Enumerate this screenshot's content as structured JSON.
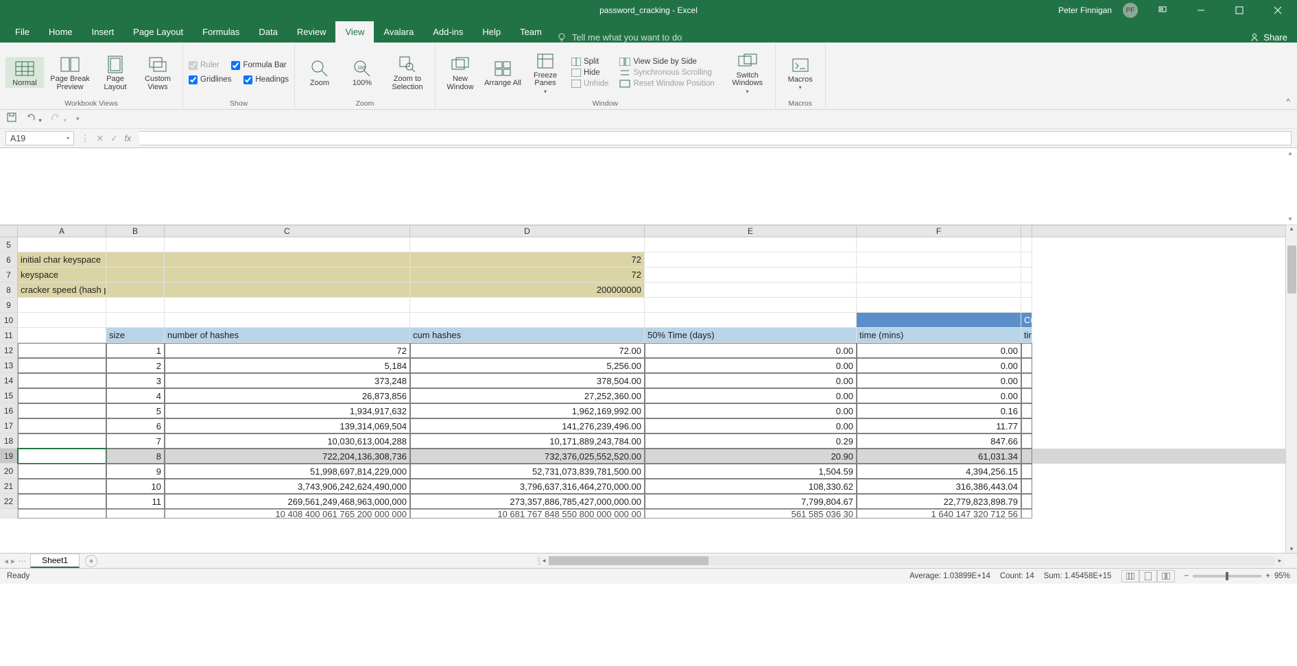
{
  "titlebar": {
    "title": "password_cracking  -  Excel",
    "user": "Peter Finnigan",
    "initials": "PF"
  },
  "ribbon": {
    "tabs": [
      "File",
      "Home",
      "Insert",
      "Page Layout",
      "Formulas",
      "Data",
      "Review",
      "View",
      "Avalara",
      "Add-ins",
      "Help",
      "Team"
    ],
    "active_tab": "View",
    "tell_me": "Tell me what you want to do",
    "share": "Share"
  },
  "view_ribbon": {
    "workbook_views": {
      "label": "Workbook Views",
      "normal": "Normal",
      "page_break": "Page Break Preview",
      "page_layout": "Page Layout",
      "custom": "Custom Views"
    },
    "show": {
      "label": "Show",
      "ruler": "Ruler",
      "formula_bar": "Formula Bar",
      "gridlines": "Gridlines",
      "headings": "Headings"
    },
    "zoom": {
      "label": "Zoom",
      "zoom": "Zoom",
      "hundred": "100%",
      "selection": "Zoom to Selection"
    },
    "window": {
      "label": "Window",
      "new_window": "New Window",
      "arrange": "Arrange All",
      "freeze": "Freeze Panes",
      "split": "Split",
      "hide": "Hide",
      "unhide": "Unhide",
      "side": "View Side by Side",
      "sync": "Synchronous Scrolling",
      "reset": "Reset Window Position",
      "switch": "Switch Windows"
    },
    "macros": {
      "label": "Macros",
      "macros": "Macros"
    }
  },
  "formula_bar": {
    "name_box": "A19",
    "fx": ""
  },
  "columns": [
    "A",
    "B",
    "C",
    "D",
    "E",
    "F"
  ],
  "first_visible_row": 5,
  "sheet": {
    "labels": {
      "initial_char": "initial char keyspace",
      "keyspace": "keyspace",
      "cracker_speed": "cracker speed (hash per second)"
    },
    "initial_char_val": "72",
    "keyspace_val": "72",
    "cracker_speed_val": "200000000",
    "table_headers": {
      "size": "size",
      "hashes": "number of hashes",
      "cum": "cum hashes",
      "days": "50% Time (days)",
      "mins": "time (mins)",
      "g_top": "Cu",
      "g_bot": "tir"
    },
    "rows": [
      {
        "n": 12,
        "b": "1",
        "c": "72",
        "d": "72.00",
        "e": "0.00",
        "f": "0.00"
      },
      {
        "n": 13,
        "b": "2",
        "c": "5,184",
        "d": "5,256.00",
        "e": "0.00",
        "f": "0.00"
      },
      {
        "n": 14,
        "b": "3",
        "c": "373,248",
        "d": "378,504.00",
        "e": "0.00",
        "f": "0.00"
      },
      {
        "n": 15,
        "b": "4",
        "c": "26,873,856",
        "d": "27,252,360.00",
        "e": "0.00",
        "f": "0.00"
      },
      {
        "n": 16,
        "b": "5",
        "c": "1,934,917,632",
        "d": "1,962,169,992.00",
        "e": "0.00",
        "f": "0.16"
      },
      {
        "n": 17,
        "b": "6",
        "c": "139,314,069,504",
        "d": "141,276,239,496.00",
        "e": "0.00",
        "f": "11.77"
      },
      {
        "n": 18,
        "b": "7",
        "c": "10,030,613,004,288",
        "d": "10,171,889,243,784.00",
        "e": "0.29",
        "f": "847.66"
      },
      {
        "n": 19,
        "b": "8",
        "c": "722,204,136,308,736",
        "d": "732,376,025,552,520.00",
        "e": "20.90",
        "f": "61,031.34"
      },
      {
        "n": 20,
        "b": "9",
        "c": "51,998,697,814,229,000",
        "d": "52,731,073,839,781,500.00",
        "e": "1,504.59",
        "f": "4,394,256.15"
      },
      {
        "n": 21,
        "b": "10",
        "c": "3,743,906,242,624,490,000",
        "d": "3,796,637,316,464,270,000.00",
        "e": "108,330.62",
        "f": "316,386,443.04"
      },
      {
        "n": 22,
        "b": "11",
        "c": "269,561,249,468,963,000,000",
        "d": "273,357,886,785,427,000,000.00",
        "e": "7,799,804.67",
        "f": "22,779,823,898.79"
      }
    ],
    "partial_row": {
      "n": "",
      "c": "10 408 400 061 765 200 000 000",
      "d": "10 681 767 848 550 800 000 000 00",
      "e": "561 585 036 30",
      "f": "1 640 147 320 712 56"
    }
  },
  "sheettab": {
    "name": "Sheet1"
  },
  "status": {
    "ready": "Ready",
    "avg": "Average: 1.03899E+14",
    "count": "Count: 14",
    "sum": "Sum: 1.45458E+15",
    "zoom": "95%"
  }
}
